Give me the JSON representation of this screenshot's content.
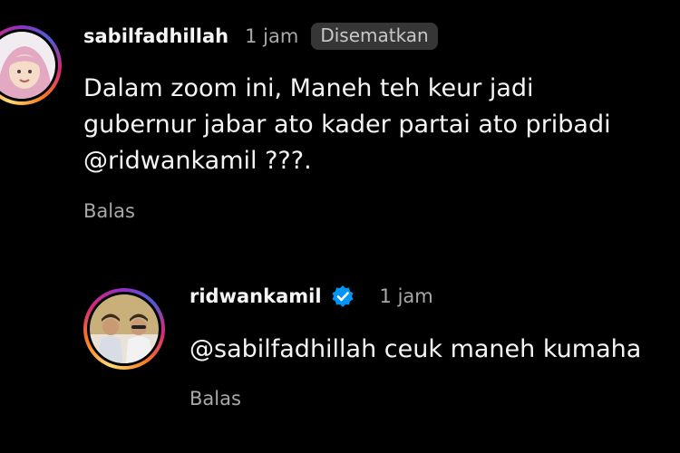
{
  "comments": [
    {
      "username": "sabilfadhillah",
      "time": "1 jam",
      "pinned_label": "Disematkan",
      "text": "Dalam zoom ini, Maneh teh keur jadi\ngubernur jabar ato kader partai ato pribadi\n@ridwankamil ???.",
      "reply_label": "Balas",
      "avatar": "profile-photo-hijab"
    }
  ],
  "reply": {
    "username": "ridwankamil",
    "time": "1 jam",
    "verified": true,
    "text": "@sabilfadhillah ceuk maneh kumaha",
    "reply_label": "Balas",
    "avatar": "profile-photo-two-men"
  },
  "colors": {
    "background": "#000000",
    "text": "#f5f5f5",
    "muted": "#a8a8a8",
    "verified": "#0095f6",
    "pinned_bg": "#363636"
  }
}
